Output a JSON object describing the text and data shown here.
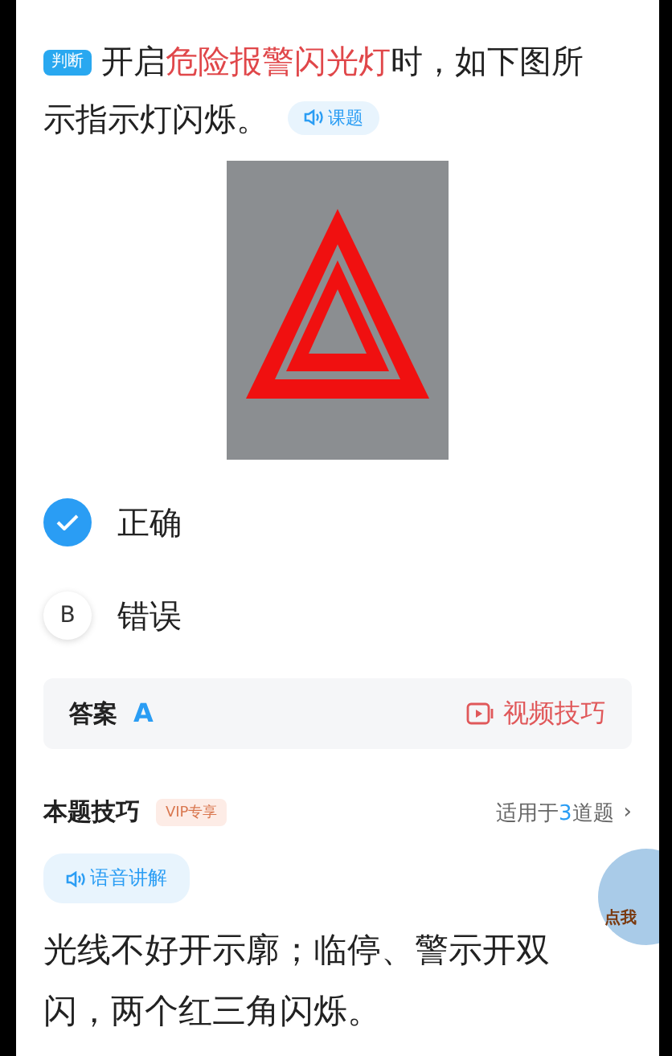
{
  "question": {
    "type_badge": "判断",
    "parts": [
      {
        "text": "开启",
        "highlight": false
      },
      {
        "text": "危险报警闪光灯",
        "highlight": true
      },
      {
        "text": "时，如下图所示指示灯闪烁。",
        "highlight": false
      }
    ],
    "audio_button": "课题"
  },
  "options": [
    {
      "label": "正确",
      "selected": true
    },
    {
      "letter": "B",
      "label": "错误",
      "selected": false
    }
  ],
  "answer": {
    "label": "答案",
    "value": "A",
    "video_link": "视频技巧"
  },
  "tips": {
    "title": "本题技巧",
    "vip_badge": "VIP专享",
    "applies_parts": [
      {
        "text": "适用于",
        "highlight": false
      },
      {
        "text": "3",
        "highlight": true
      },
      {
        "text": "道题",
        "highlight": false
      }
    ],
    "chevron": "›",
    "audio_button": "语音讲解",
    "text": "光线不好开示廓；临停、警示开双闪，两个红三角闪烁。"
  },
  "floating_helper": {
    "label": "点我"
  }
}
